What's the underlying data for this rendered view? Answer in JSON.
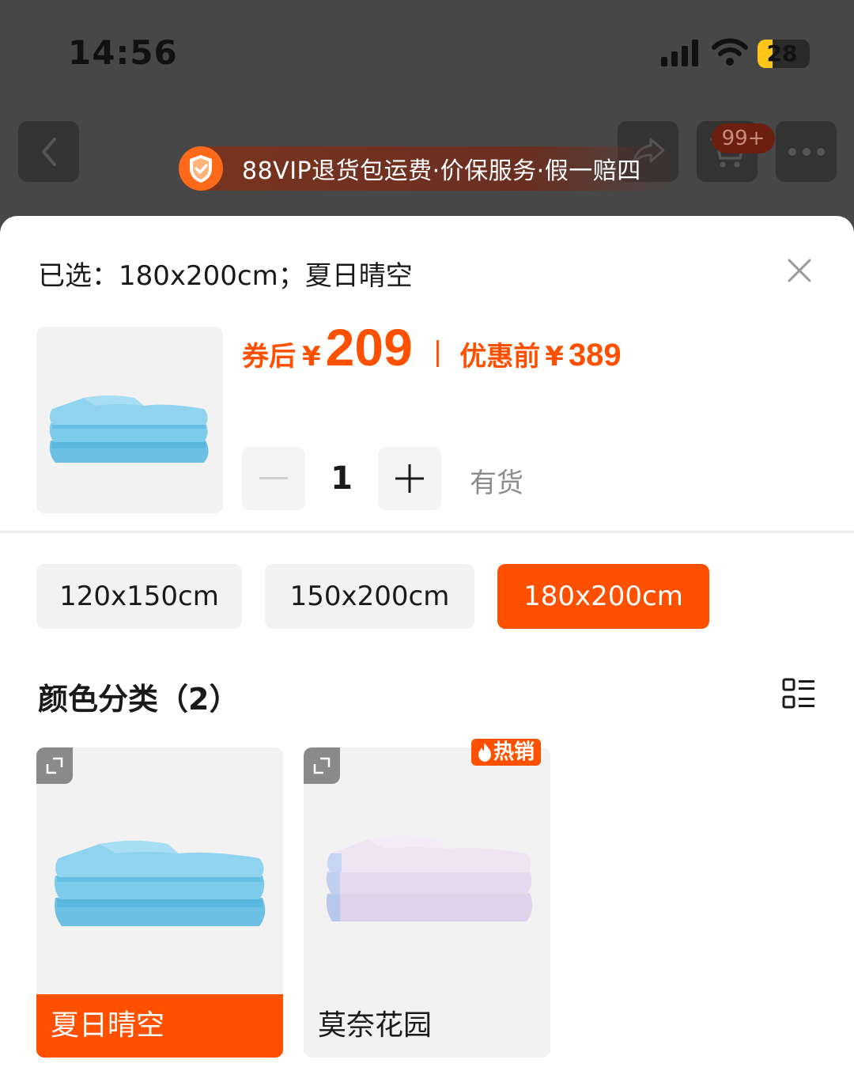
{
  "status_bar": {
    "time": "14:56",
    "battery_level": "28",
    "icons": [
      "signal-icon",
      "wifi-icon",
      "battery-icon"
    ]
  },
  "nav": {
    "icons": [
      "back-icon",
      "share-icon",
      "cart-icon",
      "more-icon"
    ],
    "cart_badge": "99+",
    "vip_banner": "88VIP退货包运费·价保服务·假一赔四"
  },
  "sheet": {
    "selected_text": "已选：180x200cm；夏日晴空",
    "price": {
      "label": "券后",
      "currency": "¥",
      "value": "209",
      "separator": "|"
    },
    "original_price": {
      "label": "优惠前",
      "currency": "¥",
      "value": "389"
    },
    "quantity": {
      "value": "1"
    },
    "stock_status": "有货",
    "sizes": [
      {
        "label": "120x150cm",
        "selected": false
      },
      {
        "label": "150x200cm",
        "selected": false
      },
      {
        "label": "180x200cm",
        "selected": true
      }
    ],
    "color_section_title": "颜色分类（2）",
    "colors": [
      {
        "label": "夏日晴空",
        "selected": true,
        "swatch": "#8fd3ee"
      },
      {
        "label": "莫奈花园",
        "selected": false,
        "swatch": "#e5d7ec",
        "badge": "热销"
      }
    ]
  },
  "theme": {
    "accent": "#ff5000",
    "dark_bg": "#474747"
  }
}
